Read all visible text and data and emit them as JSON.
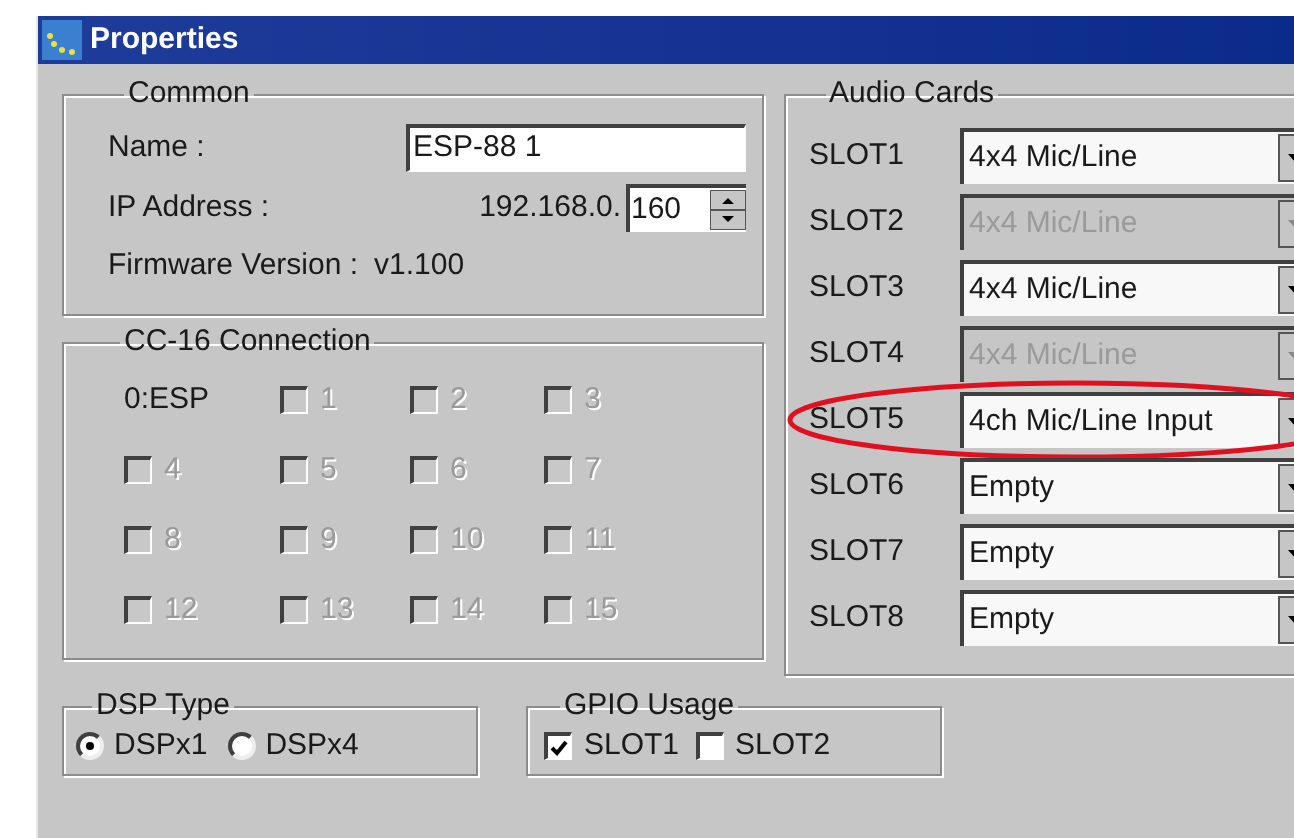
{
  "window": {
    "title": "Properties"
  },
  "common": {
    "title": "Common",
    "name_label": "Name :",
    "name_value": "ESP-88 1",
    "ip_label": "IP Address :",
    "ip_prefix": "192.168.0.",
    "ip_last": "160",
    "firmware_label": "Firmware Version :",
    "firmware_value": "v1.100"
  },
  "cc16": {
    "title": "CC-16 Connection",
    "items": [
      {
        "kind": "label",
        "label": "0:ESP"
      },
      {
        "kind": "checkbox",
        "label": "1",
        "checked": false,
        "disabled": true
      },
      {
        "kind": "checkbox",
        "label": "2",
        "checked": false,
        "disabled": true
      },
      {
        "kind": "checkbox",
        "label": "3",
        "checked": false,
        "disabled": true
      },
      {
        "kind": "checkbox",
        "label": "4",
        "checked": false,
        "disabled": true
      },
      {
        "kind": "checkbox",
        "label": "5",
        "checked": false,
        "disabled": true
      },
      {
        "kind": "checkbox",
        "label": "6",
        "checked": false,
        "disabled": true
      },
      {
        "kind": "checkbox",
        "label": "7",
        "checked": false,
        "disabled": true
      },
      {
        "kind": "checkbox",
        "label": "8",
        "checked": false,
        "disabled": true
      },
      {
        "kind": "checkbox",
        "label": "9",
        "checked": false,
        "disabled": true
      },
      {
        "kind": "checkbox",
        "label": "10",
        "checked": false,
        "disabled": true
      },
      {
        "kind": "checkbox",
        "label": "11",
        "checked": false,
        "disabled": true
      },
      {
        "kind": "checkbox",
        "label": "12",
        "checked": false,
        "disabled": true
      },
      {
        "kind": "checkbox",
        "label": "13",
        "checked": false,
        "disabled": true
      },
      {
        "kind": "checkbox",
        "label": "14",
        "checked": false,
        "disabled": true
      },
      {
        "kind": "checkbox",
        "label": "15",
        "checked": false,
        "disabled": true
      }
    ]
  },
  "audio_cards": {
    "title": "Audio Cards",
    "slots": [
      {
        "label": "SLOT1",
        "value": "4x4 Mic/Line",
        "disabled": false,
        "highlighted": false
      },
      {
        "label": "SLOT2",
        "value": "4x4 Mic/Line",
        "disabled": true,
        "highlighted": false
      },
      {
        "label": "SLOT3",
        "value": "4x4 Mic/Line",
        "disabled": false,
        "highlighted": false
      },
      {
        "label": "SLOT4",
        "value": "4x4 Mic/Line",
        "disabled": true,
        "highlighted": false
      },
      {
        "label": "SLOT5",
        "value": "4ch Mic/Line Input",
        "disabled": false,
        "highlighted": true
      },
      {
        "label": "SLOT6",
        "value": "Empty",
        "disabled": false,
        "highlighted": false
      },
      {
        "label": "SLOT7",
        "value": "Empty",
        "disabled": false,
        "highlighted": false
      },
      {
        "label": "SLOT8",
        "value": "Empty",
        "disabled": false,
        "highlighted": false
      }
    ]
  },
  "dsp_type": {
    "title": "DSP Type",
    "options": [
      {
        "label": "DSPx1",
        "selected": true
      },
      {
        "label": "DSPx4",
        "selected": false
      }
    ]
  },
  "gpio_usage": {
    "title": "GPIO Usage",
    "items": [
      {
        "label": "SLOT1",
        "checked": true
      },
      {
        "label": "SLOT2",
        "checked": false
      }
    ]
  }
}
